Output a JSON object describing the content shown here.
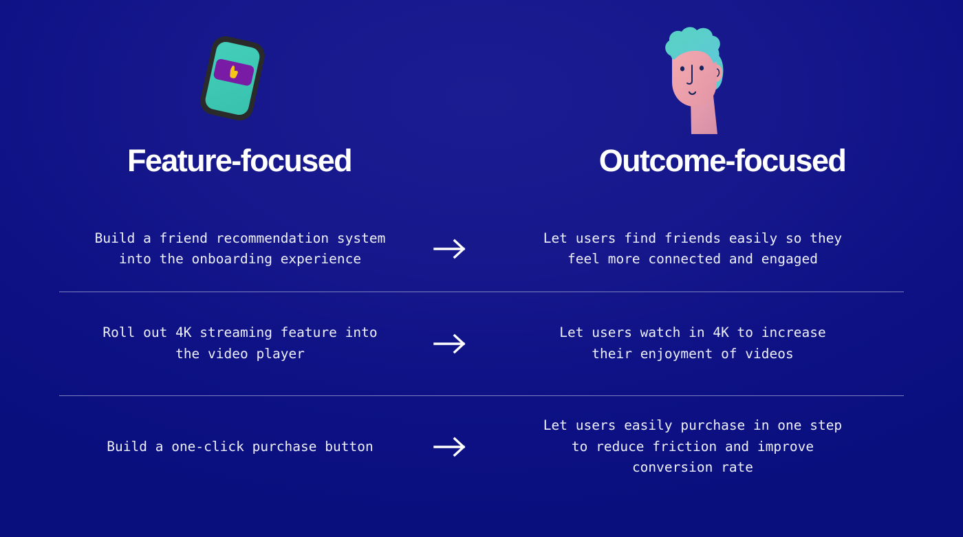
{
  "theme": {
    "background_color": "#0d1184",
    "text_color": "#eef0fb",
    "heading_color": "#ffffff",
    "divider_color": "#8f95c9",
    "accent_teal": "#3fc9b5",
    "accent_purple": "#7a1ba6",
    "accent_yellow": "#f5c518",
    "skin_color": "#f2a3a8",
    "phone_frame_color": "#2a2a2a"
  },
  "illustrations": {
    "left": {
      "name": "tilted-phone-with-cursor",
      "label": "Phone with tap cursor"
    },
    "right": {
      "name": "person-face",
      "label": "Person with curly hair"
    }
  },
  "columns": {
    "left_heading": "Feature-focused",
    "right_heading": "Outcome-focused",
    "connector": "→"
  },
  "rows": [
    {
      "feature": "Build a friend recommendation system\ninto the onboarding experience",
      "outcome": "Let users find friends easily so they\nfeel more connected and engaged"
    },
    {
      "feature": "Roll out 4K streaming feature into\nthe video player",
      "outcome": "Let users watch in 4K to increase\ntheir enjoyment of videos"
    },
    {
      "feature": "Build a one-click purchase button",
      "outcome": "Let users easily purchase in one step\nto reduce friction and improve\nconversion rate"
    }
  ]
}
